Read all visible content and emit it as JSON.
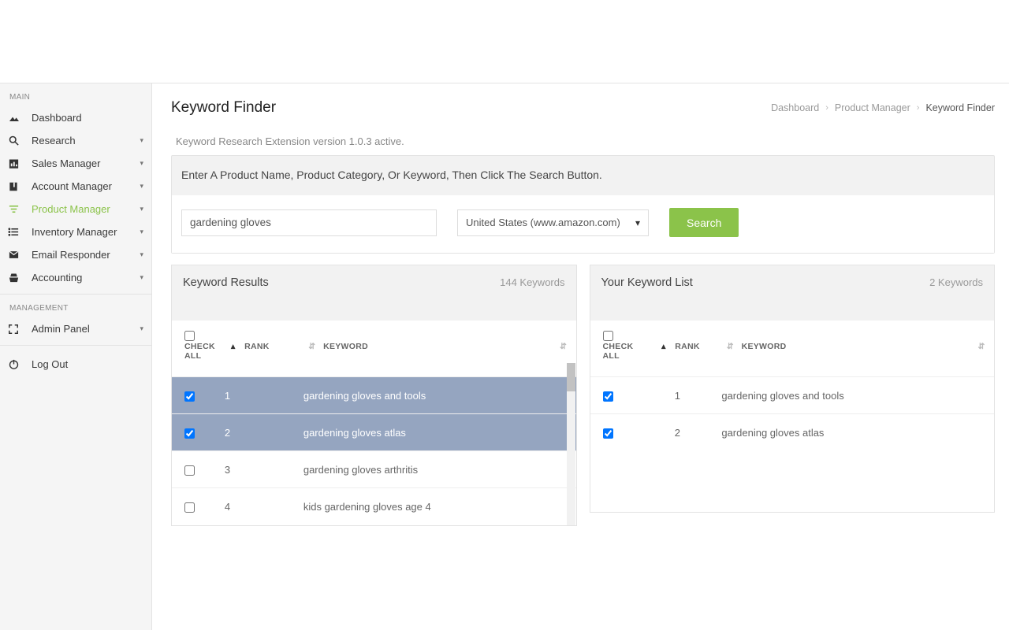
{
  "sidebar": {
    "sections": {
      "main": "MAIN",
      "management": "MANAGEMENT"
    },
    "items": [
      {
        "label": "Dashboard",
        "hasCaret": false
      },
      {
        "label": "Research",
        "hasCaret": true
      },
      {
        "label": "Sales Manager",
        "hasCaret": true
      },
      {
        "label": "Account Manager",
        "hasCaret": true
      },
      {
        "label": "Product Manager",
        "hasCaret": true
      },
      {
        "label": "Inventory Manager",
        "hasCaret": true
      },
      {
        "label": "Email Responder",
        "hasCaret": true
      },
      {
        "label": "Accounting",
        "hasCaret": true
      }
    ],
    "admin": {
      "label": "Admin Panel",
      "hasCaret": true
    },
    "logout": {
      "label": "Log Out"
    }
  },
  "header": {
    "title": "Keyword Finder",
    "breadcrumb": {
      "dashboard": "Dashboard",
      "product_manager": "Product Manager",
      "current": "Keyword Finder"
    }
  },
  "ext_status": "Keyword Research Extension version 1.0.3 active.",
  "search": {
    "instruction": "Enter A Product Name, Product Category, Or Keyword, Then Click The Search Button.",
    "value": "gardening gloves",
    "country": "United States (www.amazon.com)",
    "button": "Search"
  },
  "results": {
    "title": "Keyword Results",
    "count": "144 Keywords",
    "columnCheck": "CHECK ALL",
    "columnRank": "RANK",
    "columnKeyword": "KEYWORD",
    "rows": [
      {
        "rank": "1",
        "keyword": "gardening gloves and tools",
        "checked": true,
        "selected": true
      },
      {
        "rank": "2",
        "keyword": "gardening gloves atlas",
        "checked": true,
        "selected": true
      },
      {
        "rank": "3",
        "keyword": "gardening gloves arthritis",
        "checked": false,
        "selected": false
      },
      {
        "rank": "4",
        "keyword": "kids gardening gloves age 4",
        "checked": false,
        "selected": false
      }
    ]
  },
  "yourlist": {
    "title": "Your Keyword List",
    "count": "2 Keywords",
    "columnCheck": "CHECK ALL",
    "columnRank": "RANK",
    "columnKeyword": "KEYWORD",
    "rows": [
      {
        "rank": "1",
        "keyword": "gardening gloves and tools",
        "checked": true
      },
      {
        "rank": "2",
        "keyword": "gardening gloves atlas",
        "checked": true
      }
    ]
  }
}
